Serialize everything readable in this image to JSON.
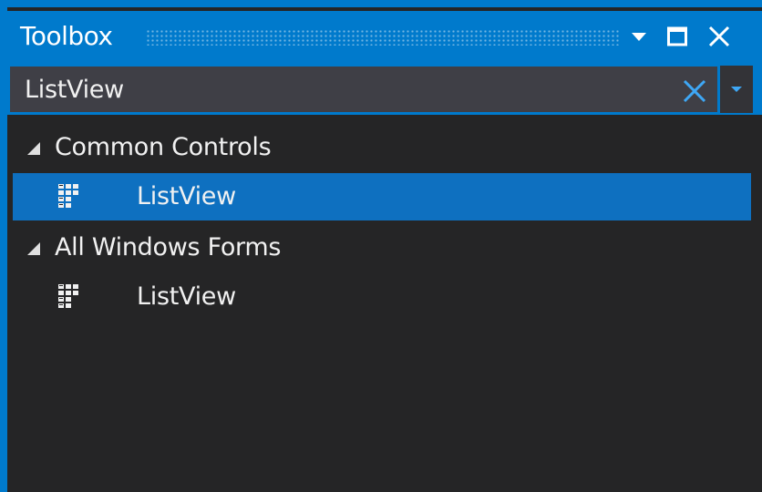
{
  "window": {
    "title": "Toolbox"
  },
  "title_buttons": {
    "dropdown_icon": "window-position-dropdown-icon",
    "maximize_icon": "maximize-icon",
    "close_icon": "close-icon"
  },
  "search": {
    "value": "ListView",
    "clear_icon": "clear-search-icon",
    "dropdown_icon": "search-options-dropdown-icon"
  },
  "tree": {
    "groups": [
      {
        "label": "Common Controls",
        "expanded": true,
        "items": [
          {
            "label": "ListView",
            "icon": "listview-control-icon",
            "selected": true
          }
        ]
      },
      {
        "label": "All Windows Forms",
        "expanded": true,
        "items": [
          {
            "label": "ListView",
            "icon": "listview-control-icon",
            "selected": false
          }
        ]
      }
    ]
  },
  "colors": {
    "accent": "#007acc",
    "selection": "#0e70c0",
    "panel_background": "#252526",
    "search_background": "#3f3f46",
    "text": "#f1f1f1"
  }
}
